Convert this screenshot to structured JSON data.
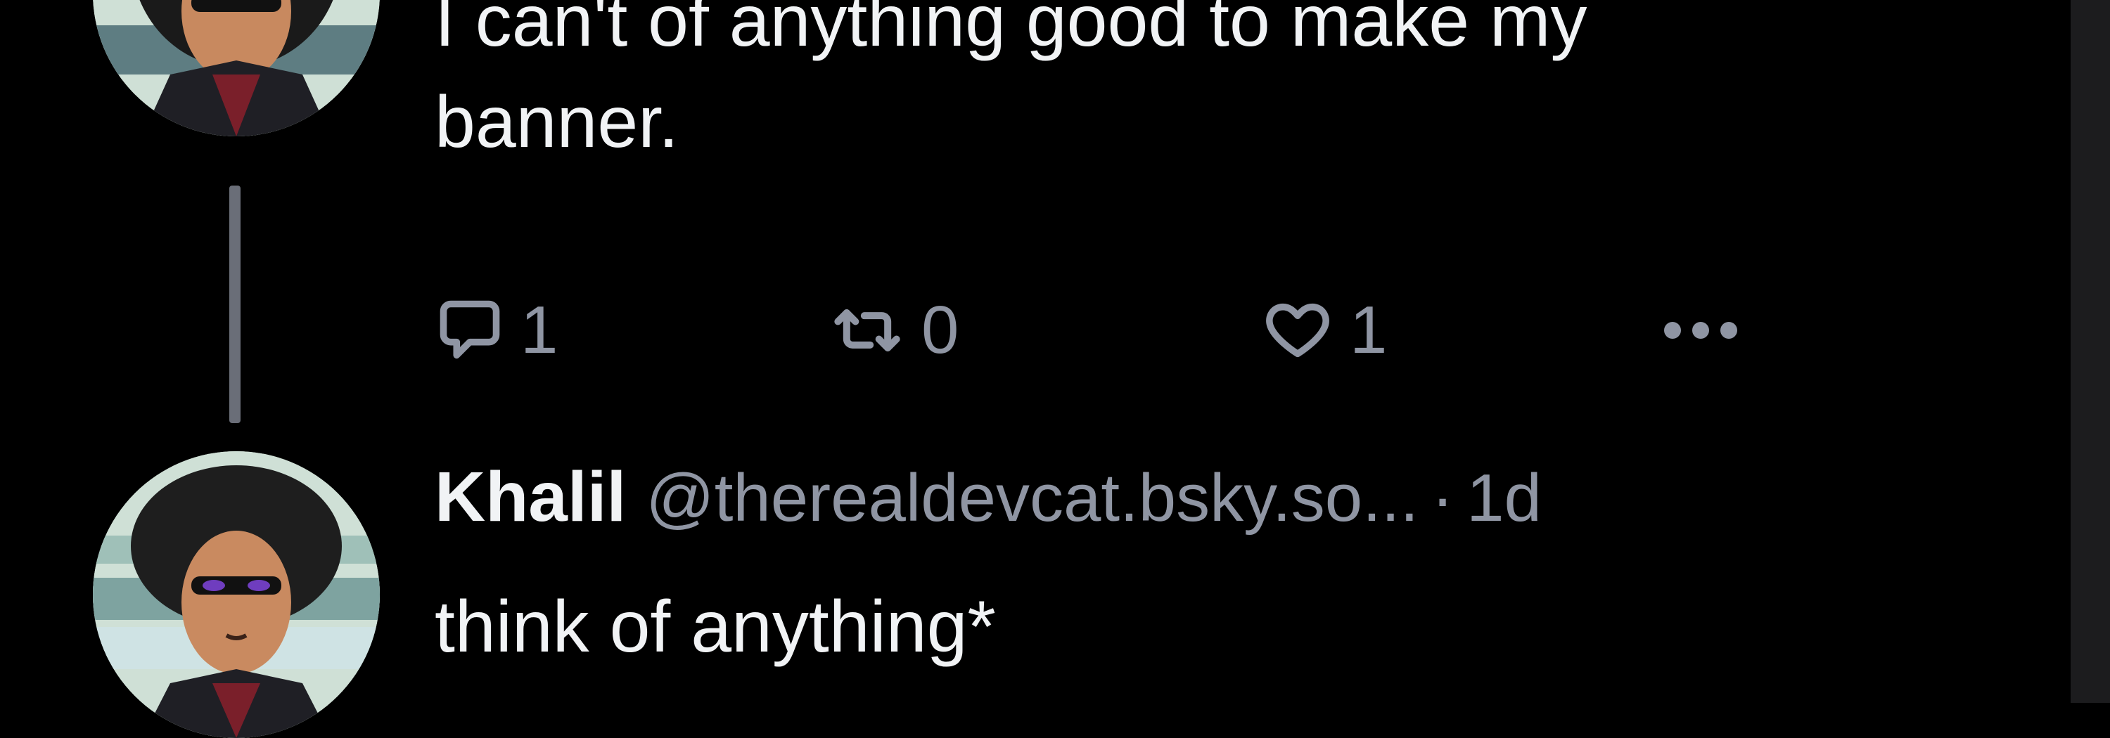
{
  "thread": {
    "parent_post": {
      "text_line_1": "I can't of anything good to make my",
      "text_line_2": "banner.",
      "actions": {
        "reply_count": "1",
        "repost_count": "0",
        "like_count": "1"
      }
    },
    "reply_post": {
      "display_name": "Khalil",
      "handle": "@therealdevcat.bsky.so...",
      "separator": "·",
      "time": "1d",
      "text": "think of anything*"
    }
  },
  "icons": {
    "reply": "reply-bubble-icon",
    "repost": "repost-icon",
    "like": "heart-icon",
    "more": "more-dots-icon"
  },
  "colors": {
    "background": "#000000",
    "text_primary": "#f1f3f5",
    "text_secondary": "#8f95a3",
    "thread_line": "#6a6e78"
  }
}
